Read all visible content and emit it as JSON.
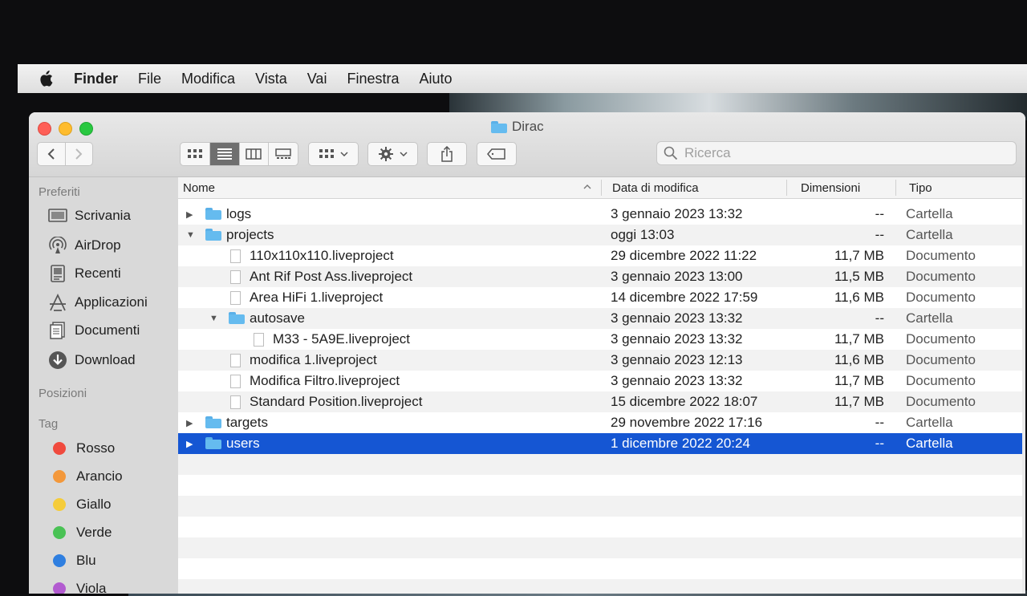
{
  "menubar": {
    "app": "Finder",
    "items": [
      "File",
      "Modifica",
      "Vista",
      "Vai",
      "Finestra",
      "Aiuto"
    ]
  },
  "window": {
    "title": "Dirac"
  },
  "search": {
    "placeholder": "Ricerca"
  },
  "sidebar": {
    "favorites_header": "Preferiti",
    "favorites": [
      {
        "label": "Scrivania",
        "icon": "desktop-icon"
      },
      {
        "label": "AirDrop",
        "icon": "airdrop-icon"
      },
      {
        "label": "Recenti",
        "icon": "recents-icon"
      },
      {
        "label": "Applicazioni",
        "icon": "applications-icon"
      },
      {
        "label": "Documenti",
        "icon": "documents-icon"
      },
      {
        "label": "Download",
        "icon": "download-icon"
      }
    ],
    "locations_header": "Posizioni",
    "tags_header": "Tag",
    "tags": [
      {
        "label": "Rosso",
        "color": "#f04a3e"
      },
      {
        "label": "Arancio",
        "color": "#f3983b"
      },
      {
        "label": "Giallo",
        "color": "#f5cc3a"
      },
      {
        "label": "Verde",
        "color": "#4ac255"
      },
      {
        "label": "Blu",
        "color": "#2f7fe0"
      },
      {
        "label": "Viola",
        "color": "#b25bd0"
      }
    ]
  },
  "columns": {
    "name": "Nome",
    "date": "Data di modifica",
    "size": "Dimensioni",
    "kind": "Tipo"
  },
  "files": [
    {
      "name": "logs",
      "date": "3 gennaio 2023 13:32",
      "size": "--",
      "kind": "Cartella"
    },
    {
      "name": "projects",
      "date": "oggi 13:03",
      "size": "--",
      "kind": "Cartella"
    },
    {
      "name": "110x110x110.liveproject",
      "date": "29 dicembre 2022 11:22",
      "size": "11,7 MB",
      "kind": "Documento"
    },
    {
      "name": "Ant Rif Post Ass.liveproject",
      "date": "3 gennaio 2023 13:00",
      "size": "11,5 MB",
      "kind": "Documento"
    },
    {
      "name": "Area HiFi 1.liveproject",
      "date": "14 dicembre 2022 17:59",
      "size": "11,6 MB",
      "kind": "Documento"
    },
    {
      "name": "autosave",
      "date": "3 gennaio 2023 13:32",
      "size": "--",
      "kind": "Cartella"
    },
    {
      "name": "M33 - 5A9E.liveproject",
      "date": "3 gennaio 2023 13:32",
      "size": "11,7 MB",
      "kind": "Documento"
    },
    {
      "name": "modifica 1.liveproject",
      "date": "3 gennaio 2023 12:13",
      "size": "11,6 MB",
      "kind": "Documento"
    },
    {
      "name": "Modifica Filtro.liveproject",
      "date": "3 gennaio 2023 13:32",
      "size": "11,7 MB",
      "kind": "Documento"
    },
    {
      "name": "Standard Position.liveproject",
      "date": "15 dicembre 2022 18:07",
      "size": "11,7 MB",
      "kind": "Documento"
    },
    {
      "name": "targets",
      "date": "29 novembre 2022 17:16",
      "size": "--",
      "kind": "Cartella"
    },
    {
      "name": "users",
      "date": "1 dicembre 2022 20:24",
      "size": "--",
      "kind": "Cartella"
    }
  ]
}
